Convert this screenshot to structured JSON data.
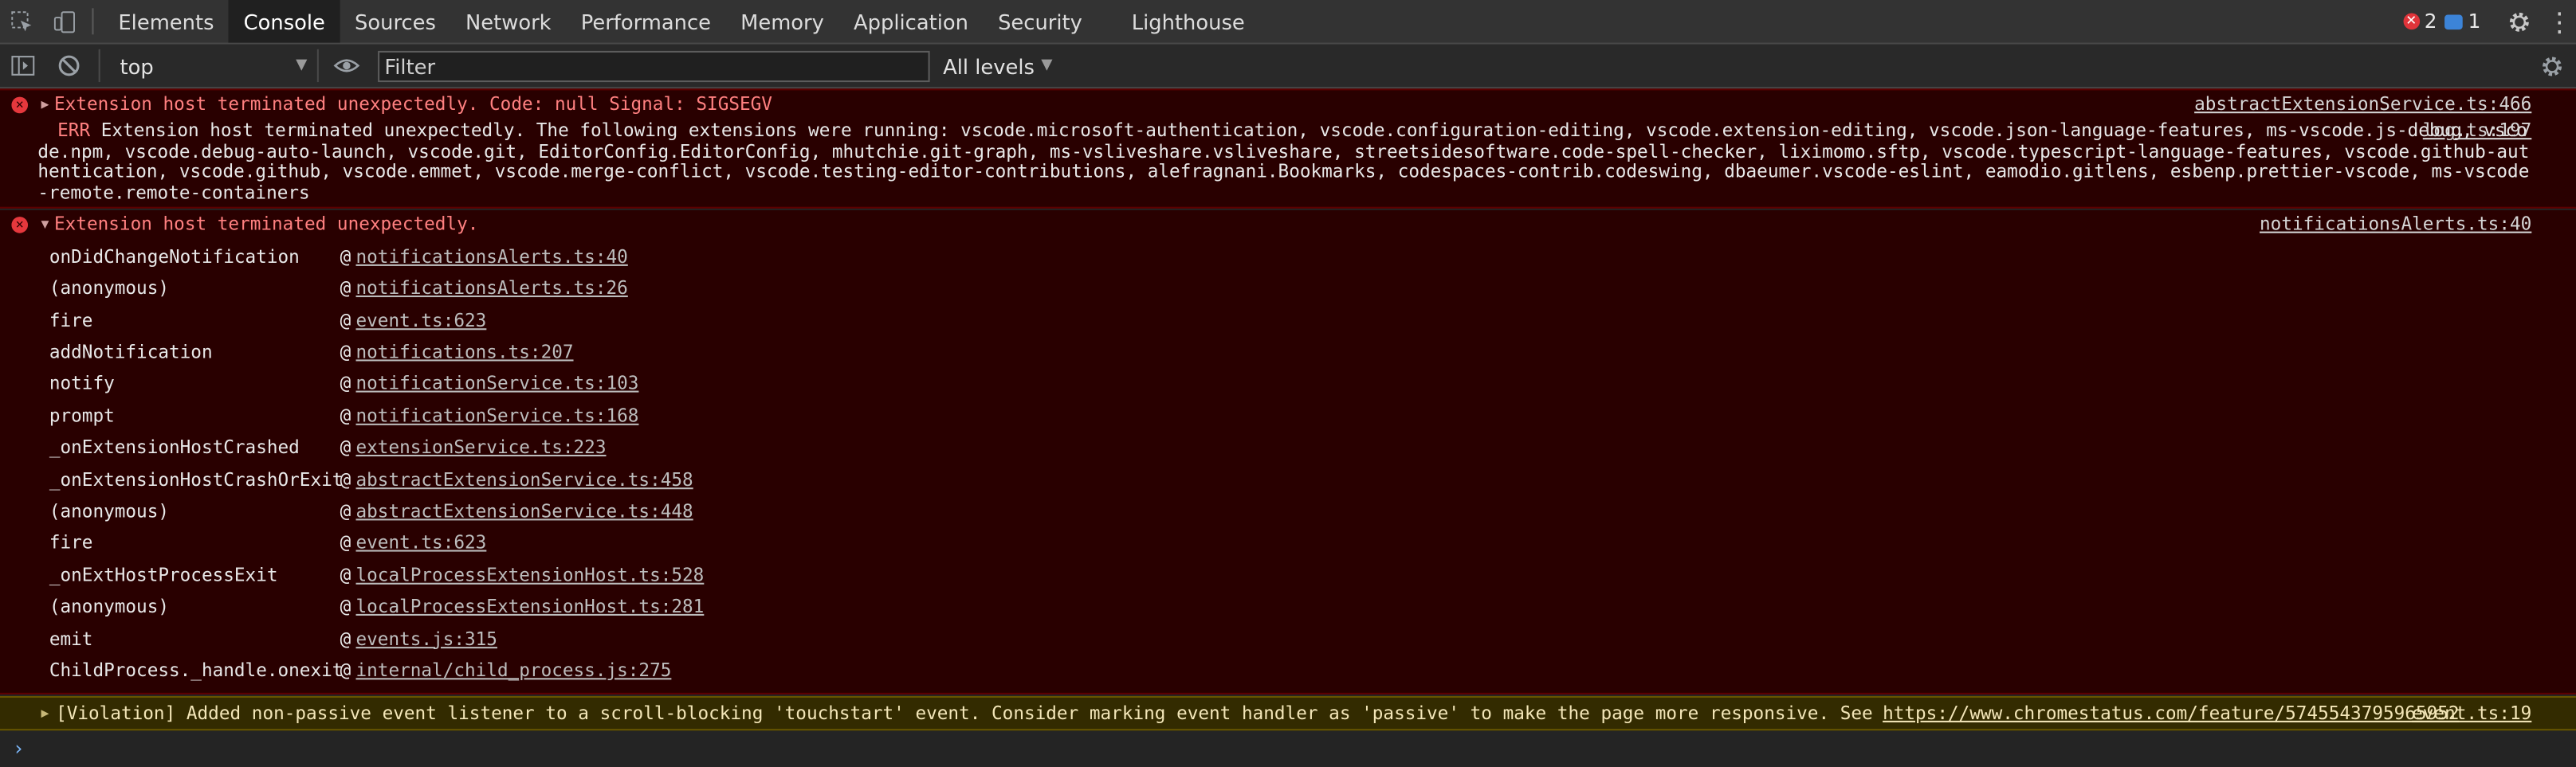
{
  "tabs": [
    "Elements",
    "Console",
    "Sources",
    "Network",
    "Performance",
    "Memory",
    "Application",
    "Security",
    "Lighthouse"
  ],
  "active_tab": "Console",
  "badges": {
    "errors": "2",
    "info": "1"
  },
  "toolbar": {
    "context": "top",
    "filter_placeholder": "Filter",
    "levels": "All levels"
  },
  "messages": {
    "msg1": {
      "text": "Extension host terminated unexpectedly. Code:  null  Signal:  SIGSEGV",
      "source": "abstractExtensionService.ts:466",
      "err_label": "ERR",
      "detail": "Extension host terminated unexpectedly. The following extensions were running: vscode.microsoft-authentication, vscode.configuration-editing, vscode.extension-editing, vscode.json-language-features, ms-vscode.js-debug, vscode.npm, vscode.debug-auto-launch, vscode.git, EditorConfig.EditorConfig, mhutchie.git-graph, ms-vsliveshare.vsliveshare, streetsidesoftware.code-spell-checker, liximomo.sftp, vscode.typescript-language-features, vscode.github-authentication, vscode.github, vscode.emmet, vscode.merge-conflict, vscode.testing-editor-contributions, alefragnani.Bookmarks, codespaces-contrib.codeswing, dbaeumer.vscode-eslint, eamodio.gitlens, esbenp.prettier-vscode, ms-vscode-remote.remote-containers",
      "log_source": "log.ts:197"
    },
    "msg2": {
      "text": "Extension host terminated unexpectedly.",
      "source": "notificationsAlerts.ts:40",
      "stack": [
        {
          "fn": "onDidChangeNotification",
          "loc": "notificationsAlerts.ts:40"
        },
        {
          "fn": "(anonymous)",
          "loc": "notificationsAlerts.ts:26"
        },
        {
          "fn": "fire",
          "loc": "event.ts:623"
        },
        {
          "fn": "addNotification",
          "loc": "notifications.ts:207"
        },
        {
          "fn": "notify",
          "loc": "notificationService.ts:103"
        },
        {
          "fn": "prompt",
          "loc": "notificationService.ts:168"
        },
        {
          "fn": "_onExtensionHostCrashed",
          "loc": "extensionService.ts:223"
        },
        {
          "fn": "_onExtensionHostCrashOrExit",
          "loc": "abstractExtensionService.ts:458"
        },
        {
          "fn": "(anonymous)",
          "loc": "abstractExtensionService.ts:448"
        },
        {
          "fn": "fire",
          "loc": "event.ts:623"
        },
        {
          "fn": "_onExtHostProcessExit",
          "loc": "localProcessExtensionHost.ts:528"
        },
        {
          "fn": "(anonymous)",
          "loc": "localProcessExtensionHost.ts:281"
        },
        {
          "fn": "emit",
          "loc": "events.js:315"
        },
        {
          "fn": "ChildProcess._handle.onexit",
          "loc": "internal/child_process.js:275"
        }
      ]
    },
    "warning": {
      "text": "[Violation] Added non-passive event listener to a scroll-blocking 'touchstart' event. Consider marking event handler as 'passive' to make the page more responsive. See",
      "url": "https://www.chromestatus.com/feature/5745543795965952",
      "source": "event.ts:19"
    }
  },
  "prompt_symbol": "›"
}
